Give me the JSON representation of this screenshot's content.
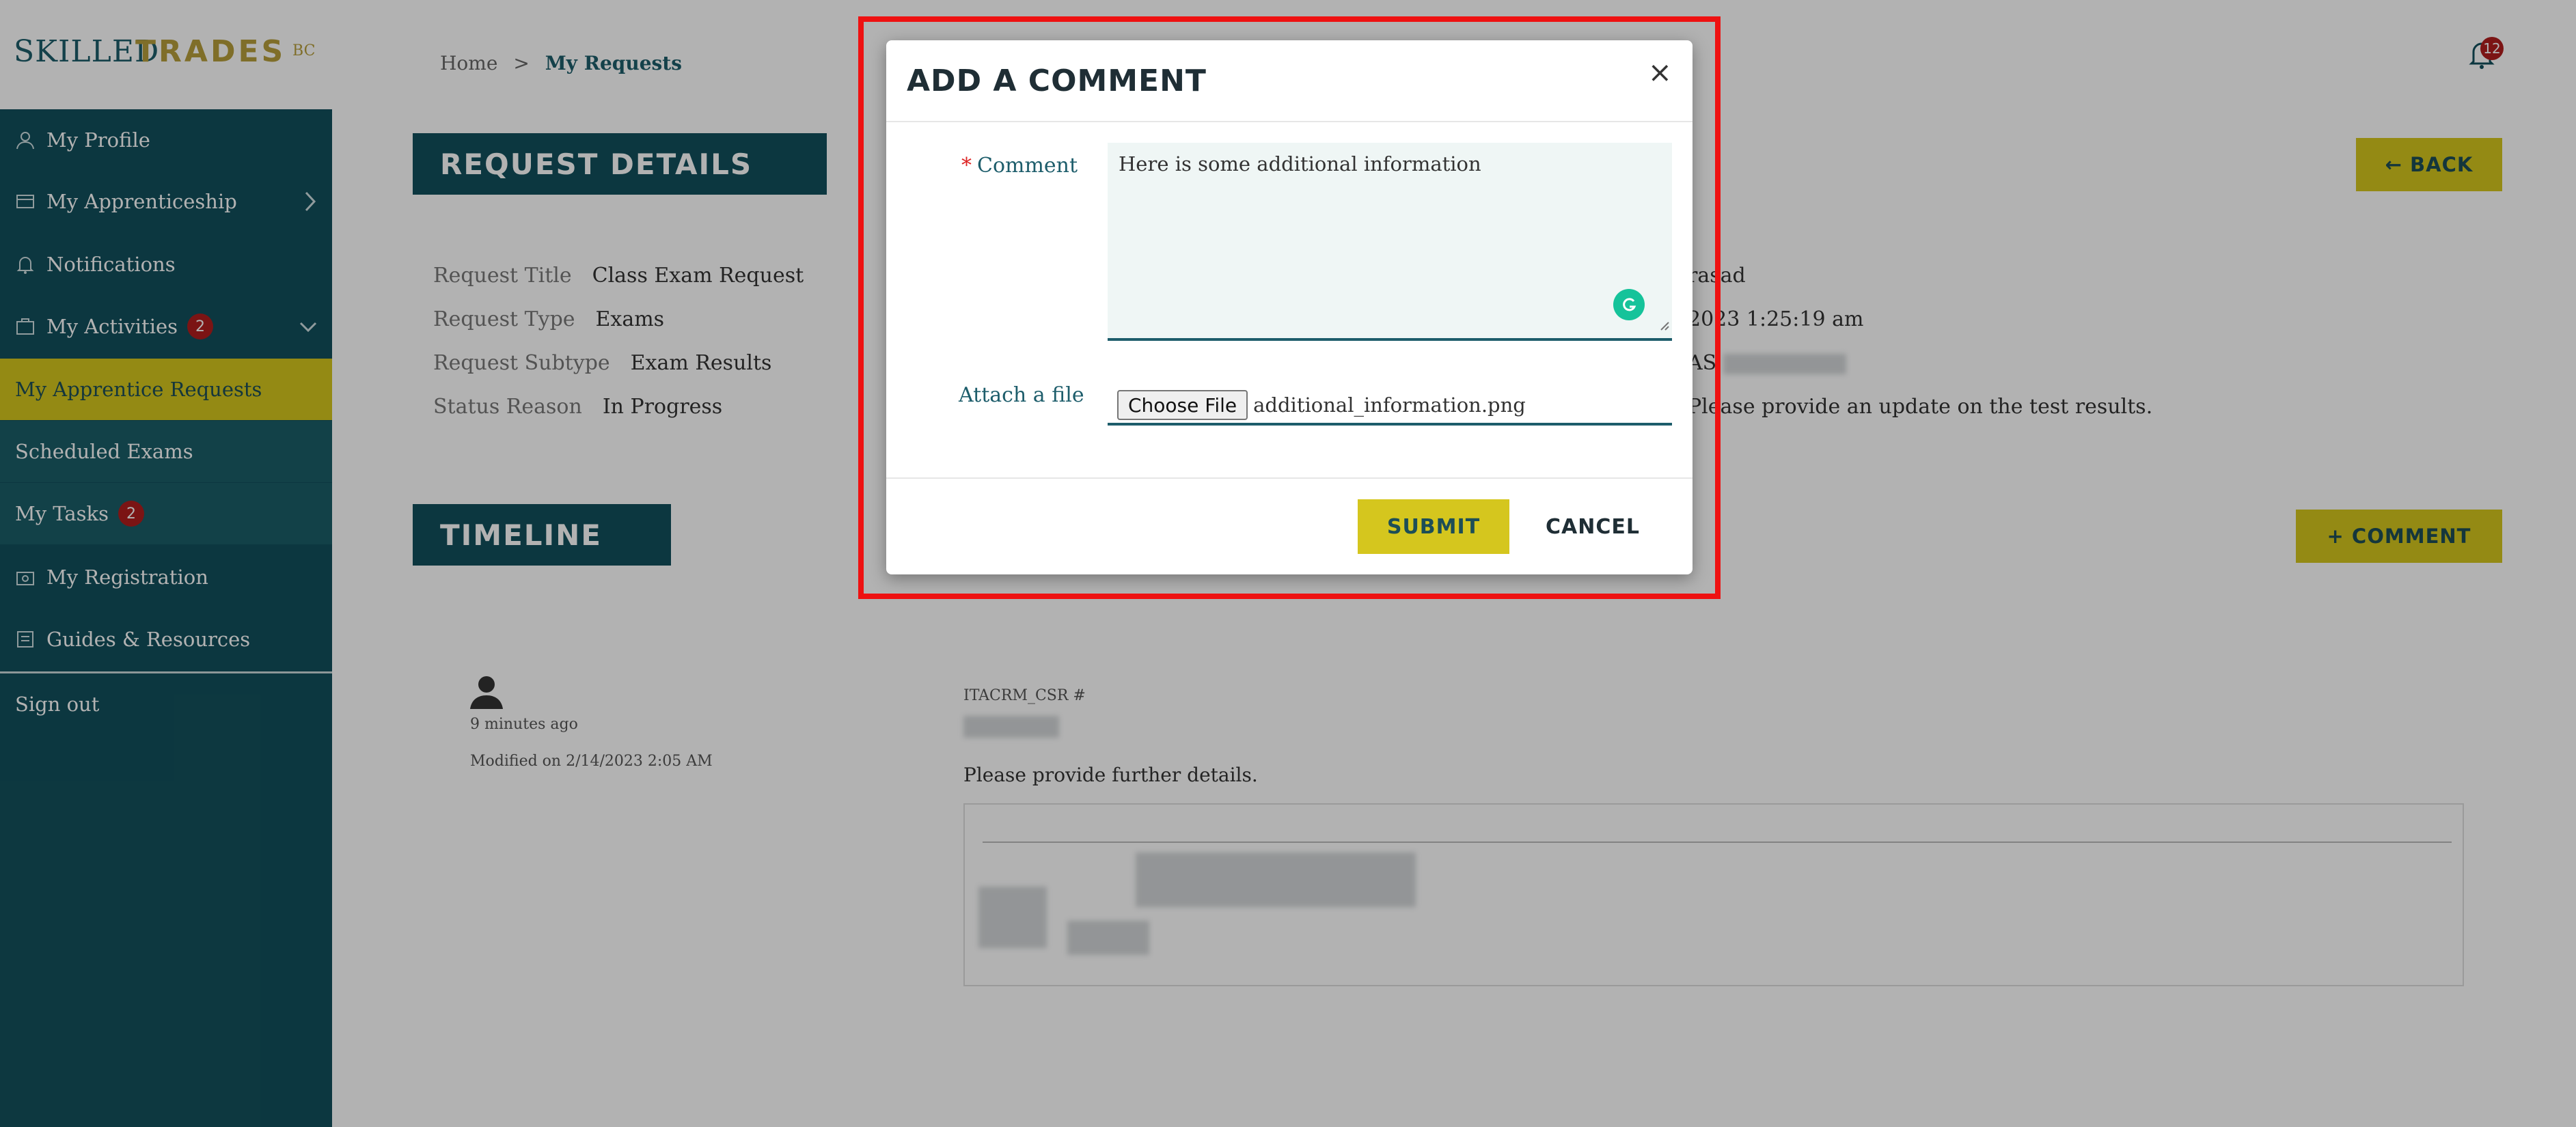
{
  "logo": {
    "part1": "SKILLED",
    "part2": "TRADES",
    "part3": "BC"
  },
  "sidebar": {
    "items": [
      {
        "label": "My Profile",
        "icon": "user-icon"
      },
      {
        "label": "My Apprenticeship",
        "icon": "apprenticeship-icon"
      },
      {
        "label": "Notifications",
        "icon": "bell-icon"
      },
      {
        "label": "My Activities",
        "icon": "activities-icon",
        "badge": "2"
      },
      {
        "label": "My Apprentice Requests"
      },
      {
        "label": "Scheduled Exams"
      },
      {
        "label": "My Tasks",
        "badge": "2"
      },
      {
        "label": "My Registration",
        "icon": "registration-icon"
      },
      {
        "label": "Guides & Resources",
        "icon": "resources-icon"
      },
      {
        "label": "Sign out"
      }
    ]
  },
  "header": {
    "notification_count": "12"
  },
  "breadcrumb": {
    "home": "Home",
    "separator": ">",
    "current": "My Requests"
  },
  "request_details": {
    "title": "REQUEST DETAILS",
    "back_label": "← BACK",
    "fields": [
      {
        "key": "Request Title",
        "value": "Class Exam Request"
      },
      {
        "key": "Request Type",
        "value": "Exams"
      },
      {
        "key": "Request Subtype",
        "value": "Exam Results"
      },
      {
        "key": "Status Reason",
        "value": "In Progress"
      }
    ],
    "right_col": {
      "line1": "rasad",
      "line2": "2023 1:25:19 am",
      "line3": "AS",
      "line4": "Please provide an update on the test results."
    }
  },
  "timeline": {
    "title": "TIMELINE",
    "comment_button": "+ COMMENT",
    "entry": {
      "time_ago": "9 minutes ago",
      "modified": "Modified on 2/14/2023 2:05 AM",
      "author": "ITACRM_CSR #",
      "text": "Please provide further details."
    }
  },
  "modal": {
    "title": "ADD A COMMENT",
    "close": "×",
    "comment_label": "Comment",
    "required_mark": "*",
    "comment_value": "Here is some additional information",
    "attach_label": "Attach a file",
    "choose_file": "Choose File",
    "file_name": "additional_information.png",
    "submit": "SUBMIT",
    "cancel": "CANCEL"
  },
  "colors": {
    "sidebar": "#12505c",
    "accent_gold": "#d5c61e",
    "highlight_border": "#ee1111",
    "badge": "#b01e1e"
  }
}
